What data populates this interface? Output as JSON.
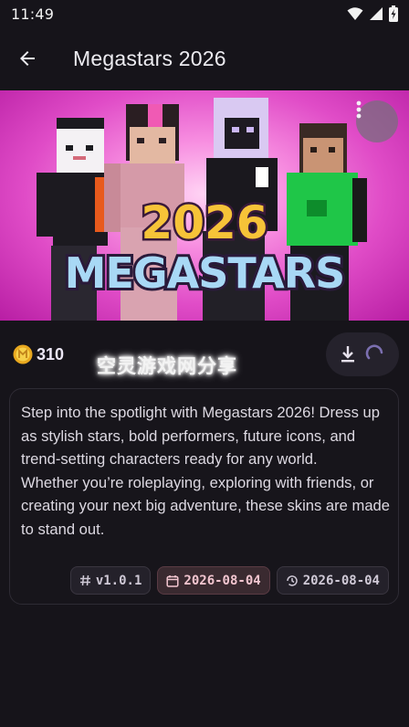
{
  "status_bar": {
    "time": "11:49"
  },
  "app_bar": {
    "title": "Megastars 2026"
  },
  "banner": {
    "title_line1": "2026",
    "title_line2": "MEGASTARS"
  },
  "item": {
    "price": "310",
    "watermark": "空灵游戏网分享"
  },
  "description": {
    "paragraph1": "Step into the spotlight with Megastars 2026! Dress up as stylish stars, bold performers, future icons, and trend-setting characters ready for any world.",
    "paragraph2": "Whether you’re roleplaying, exploring with friends, or creating your next big adventure, these skins are made to stand out."
  },
  "tags": {
    "version": "v1.0.1",
    "created": "2026-08-04",
    "updated": "2026-08-04"
  },
  "colors": {
    "background": "#16141a",
    "banner_pink": "#e04cc7",
    "date_tag": "#3a2a30"
  }
}
